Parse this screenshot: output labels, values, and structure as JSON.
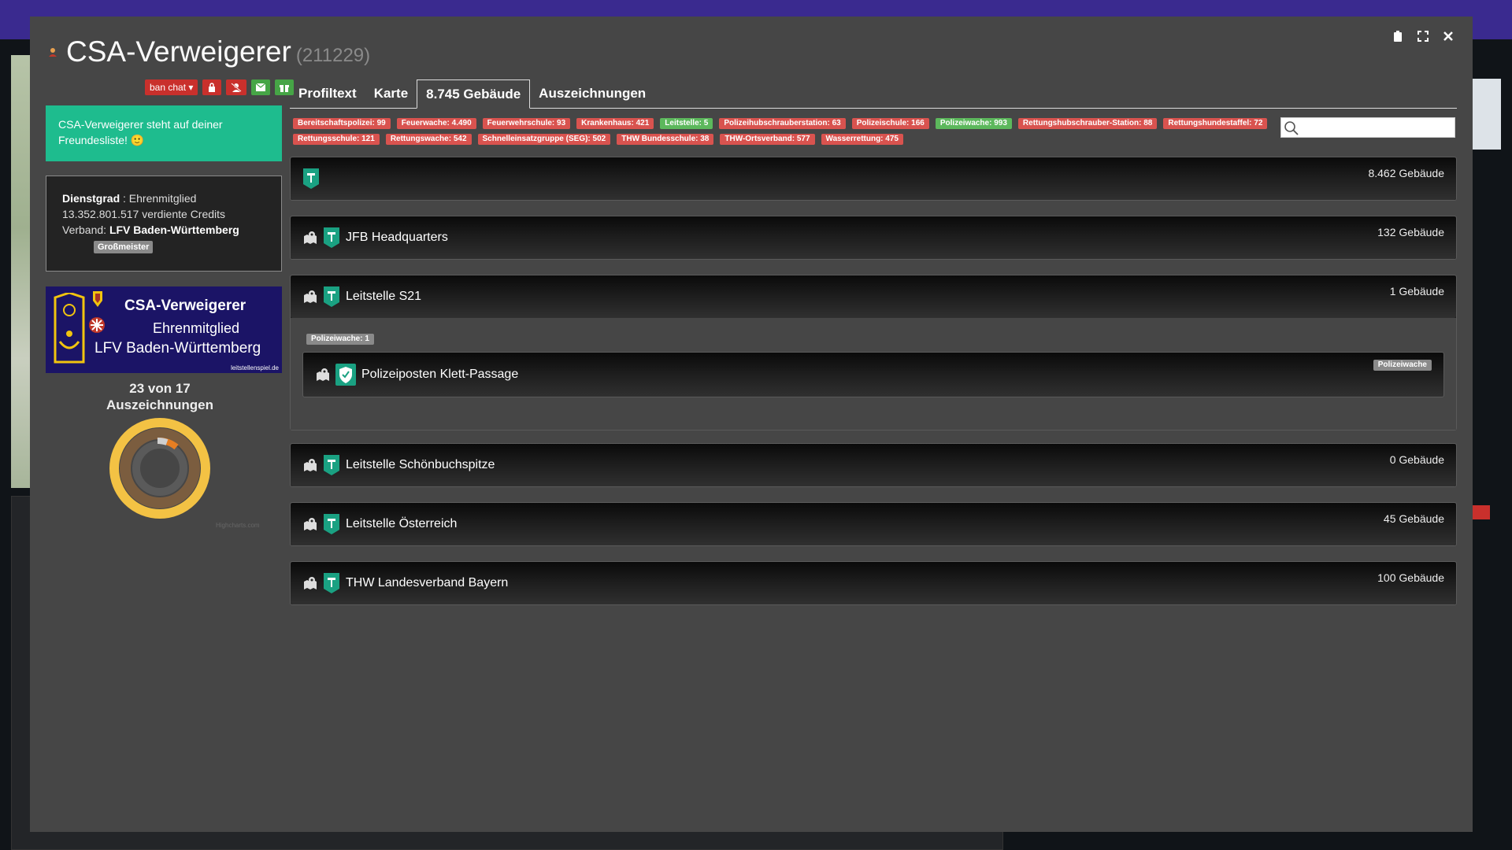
{
  "modal": {
    "title": "CSA-Verweigerer",
    "user_id": "(211229)"
  },
  "actions": {
    "ban_chat_label": "ban chat ▾"
  },
  "friend_notice": "CSA-Verweigerer steht auf deiner Freundesliste! 🙂",
  "profile": {
    "rank_label": "Dienstgrad",
    "rank_value": ": Ehrenmitglied",
    "credits": "13.352.801.517 verdiente Credits",
    "verband_label": "Verband: ",
    "verband_value": "LFV Baden-Württemberg",
    "badge": "Großmeister"
  },
  "banner": {
    "name": "CSA-Verweigerer",
    "rank": "Ehrenmitglied",
    "verband": "LFV Baden-Württemberg",
    "url": "leitstellenspiel.de"
  },
  "awards": {
    "line1": "23 von 17",
    "line2": "Auszeichnungen",
    "credit": "Highcharts.com"
  },
  "tabs": [
    "Profiltext",
    "Karte",
    "8.745 Gebäude",
    "Auszeichnungen"
  ],
  "building_counts": [
    {
      "text": "Bereitschaftspolizei: 99",
      "color": "#d9534f"
    },
    {
      "text": "Feuerwache: 4.490",
      "color": "#d9534f"
    },
    {
      "text": "Feuerwehrschule: 93",
      "color": "#d9534f"
    },
    {
      "text": "Krankenhaus: 421",
      "color": "#d9534f"
    },
    {
      "text": "Leitstelle: 5",
      "color": "#5cb85c"
    },
    {
      "text": "Polizeihubschrauberstation: 63",
      "color": "#d9534f"
    },
    {
      "text": "Polizeischule: 166",
      "color": "#d9534f"
    },
    {
      "text": "Polizeiwache: 993",
      "color": "#5cb85c"
    },
    {
      "text": "Rettungshubschrauber-Station: 88",
      "color": "#d9534f"
    },
    {
      "text": "Rettungshundestaffel: 72",
      "color": "#d9534f"
    },
    {
      "text": "Rettungsschule: 121",
      "color": "#d9534f"
    },
    {
      "text": "Rettungswache: 542",
      "color": "#d9534f"
    },
    {
      "text": "Schnelleinsatzgruppe (SEG): 502",
      "color": "#d9534f"
    },
    {
      "text": "THW Bundesschule: 38",
      "color": "#d9534f"
    },
    {
      "text": "THW-Ortsverband: 577",
      "color": "#d9534f"
    },
    {
      "text": "Wasserrettung: 475",
      "color": "#d9534f"
    }
  ],
  "search": {
    "placeholder": ""
  },
  "leitstellen": [
    {
      "name": "",
      "count": "8.462 Gebäude",
      "has_map": false
    },
    {
      "name": "JFB Headquarters",
      "count": "132 Gebäude",
      "has_map": true
    },
    {
      "name": "Leitstelle S21",
      "count": "1 Gebäude",
      "has_map": true
    },
    {
      "name": "Leitstelle Schönbuchspitze",
      "count": "0 Gebäude",
      "has_map": true
    },
    {
      "name": "Leitstelle Österreich",
      "count": "45 Gebäude",
      "has_map": true
    },
    {
      "name": "THW Landesverband Bayern",
      "count": "100 Gebäude",
      "has_map": true
    }
  ],
  "expanded": {
    "summary_label": "Polizeiwache: 1",
    "building_name": "Polizeiposten Klett-Passage",
    "building_type": "Polizeiwache"
  },
  "colors": {
    "modal_bg": "#464646",
    "friend_green": "#1ebc8e",
    "label_red": "#d9534f",
    "label_green": "#5cb85c",
    "leitstelle_teal": "#1aa182"
  }
}
